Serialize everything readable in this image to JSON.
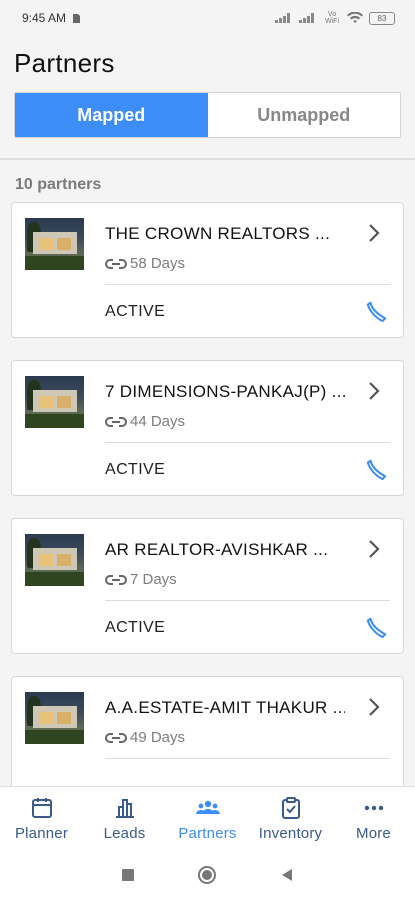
{
  "status_bar": {
    "time": "9:45 AM",
    "network_label": "Vo WiFi",
    "battery": "83"
  },
  "header": {
    "title": "Partners",
    "tabs": [
      {
        "label": "Mapped",
        "active": true
      },
      {
        "label": "Unmapped",
        "active": false
      }
    ]
  },
  "count_label": "10 partners",
  "partners": [
    {
      "name": "THE CROWN REALTORS ...",
      "linked_days": "58 Days",
      "status": "ACTIVE"
    },
    {
      "name": "7 DIMENSIONS-PANKAJ(P) ...",
      "linked_days": "44 Days",
      "status": "ACTIVE"
    },
    {
      "name": "AR REALTOR-AVISHKAR ...",
      "linked_days": "7 Days",
      "status": "ACTIVE"
    },
    {
      "name": "A.A.ESTATE-AMIT THAKUR ...",
      "linked_days": "49 Days",
      "status": ""
    }
  ],
  "bottom_nav": [
    {
      "label": "Planner",
      "icon": "calendar-icon"
    },
    {
      "label": "Leads",
      "icon": "bar-chart-icon"
    },
    {
      "label": "Partners",
      "icon": "people-icon",
      "active": true
    },
    {
      "label": "Inventory",
      "icon": "clipboard-check-icon"
    },
    {
      "label": "More",
      "icon": "more-dots-icon"
    }
  ],
  "colors": {
    "accent": "#3c8df5",
    "nav_text": "#3a5a8a",
    "background": "#f4f4f4"
  }
}
